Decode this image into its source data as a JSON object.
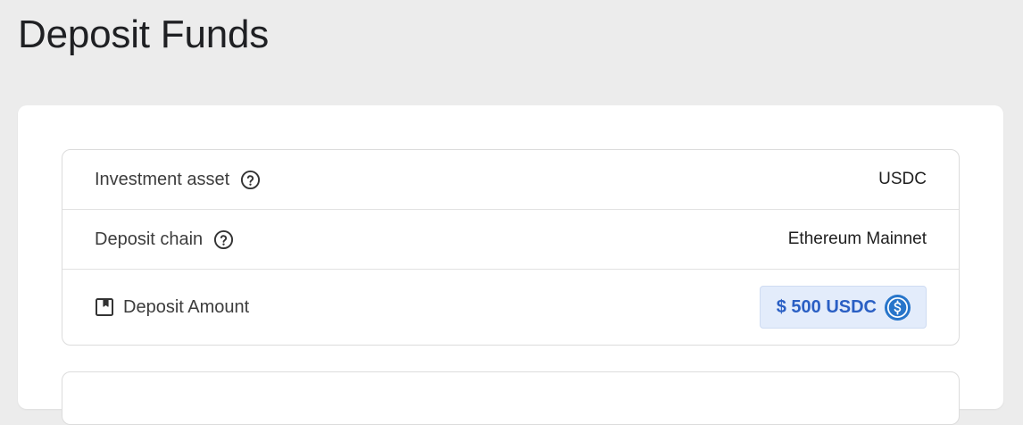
{
  "page": {
    "title": "Deposit Funds"
  },
  "details": {
    "rows": [
      {
        "label": "Investment asset",
        "value": "USDC",
        "icon": "help-icon"
      },
      {
        "label": "Deposit chain",
        "value": "Ethereum Mainnet",
        "icon": "help-icon"
      },
      {
        "label": "Deposit Amount",
        "value": "$ 500 USDC",
        "icon": "book-icon"
      }
    ]
  },
  "colors": {
    "background": "#ececec",
    "amount_badge_bg": "#e3ecfb",
    "amount_text": "#2a5fc4",
    "usdc_blue": "#2775ca"
  }
}
